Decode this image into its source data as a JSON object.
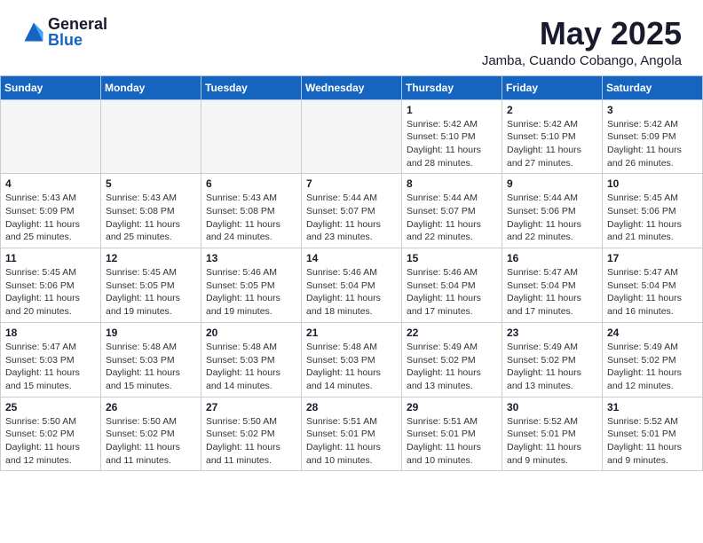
{
  "logo": {
    "general": "General",
    "blue": "Blue"
  },
  "title": {
    "month": "May 2025",
    "location": "Jamba, Cuando Cobango, Angola"
  },
  "weekdays": [
    "Sunday",
    "Monday",
    "Tuesday",
    "Wednesday",
    "Thursday",
    "Friday",
    "Saturday"
  ],
  "weeks": [
    [
      {
        "day": "",
        "detail": ""
      },
      {
        "day": "",
        "detail": ""
      },
      {
        "day": "",
        "detail": ""
      },
      {
        "day": "",
        "detail": ""
      },
      {
        "day": "1",
        "detail": "Sunrise: 5:42 AM\nSunset: 5:10 PM\nDaylight: 11 hours and 28 minutes."
      },
      {
        "day": "2",
        "detail": "Sunrise: 5:42 AM\nSunset: 5:10 PM\nDaylight: 11 hours and 27 minutes."
      },
      {
        "day": "3",
        "detail": "Sunrise: 5:42 AM\nSunset: 5:09 PM\nDaylight: 11 hours and 26 minutes."
      }
    ],
    [
      {
        "day": "4",
        "detail": "Sunrise: 5:43 AM\nSunset: 5:09 PM\nDaylight: 11 hours and 25 minutes."
      },
      {
        "day": "5",
        "detail": "Sunrise: 5:43 AM\nSunset: 5:08 PM\nDaylight: 11 hours and 25 minutes."
      },
      {
        "day": "6",
        "detail": "Sunrise: 5:43 AM\nSunset: 5:08 PM\nDaylight: 11 hours and 24 minutes."
      },
      {
        "day": "7",
        "detail": "Sunrise: 5:44 AM\nSunset: 5:07 PM\nDaylight: 11 hours and 23 minutes."
      },
      {
        "day": "8",
        "detail": "Sunrise: 5:44 AM\nSunset: 5:07 PM\nDaylight: 11 hours and 22 minutes."
      },
      {
        "day": "9",
        "detail": "Sunrise: 5:44 AM\nSunset: 5:06 PM\nDaylight: 11 hours and 22 minutes."
      },
      {
        "day": "10",
        "detail": "Sunrise: 5:45 AM\nSunset: 5:06 PM\nDaylight: 11 hours and 21 minutes."
      }
    ],
    [
      {
        "day": "11",
        "detail": "Sunrise: 5:45 AM\nSunset: 5:06 PM\nDaylight: 11 hours and 20 minutes."
      },
      {
        "day": "12",
        "detail": "Sunrise: 5:45 AM\nSunset: 5:05 PM\nDaylight: 11 hours and 19 minutes."
      },
      {
        "day": "13",
        "detail": "Sunrise: 5:46 AM\nSunset: 5:05 PM\nDaylight: 11 hours and 19 minutes."
      },
      {
        "day": "14",
        "detail": "Sunrise: 5:46 AM\nSunset: 5:04 PM\nDaylight: 11 hours and 18 minutes."
      },
      {
        "day": "15",
        "detail": "Sunrise: 5:46 AM\nSunset: 5:04 PM\nDaylight: 11 hours and 17 minutes."
      },
      {
        "day": "16",
        "detail": "Sunrise: 5:47 AM\nSunset: 5:04 PM\nDaylight: 11 hours and 17 minutes."
      },
      {
        "day": "17",
        "detail": "Sunrise: 5:47 AM\nSunset: 5:04 PM\nDaylight: 11 hours and 16 minutes."
      }
    ],
    [
      {
        "day": "18",
        "detail": "Sunrise: 5:47 AM\nSunset: 5:03 PM\nDaylight: 11 hours and 15 minutes."
      },
      {
        "day": "19",
        "detail": "Sunrise: 5:48 AM\nSunset: 5:03 PM\nDaylight: 11 hours and 15 minutes."
      },
      {
        "day": "20",
        "detail": "Sunrise: 5:48 AM\nSunset: 5:03 PM\nDaylight: 11 hours and 14 minutes."
      },
      {
        "day": "21",
        "detail": "Sunrise: 5:48 AM\nSunset: 5:03 PM\nDaylight: 11 hours and 14 minutes."
      },
      {
        "day": "22",
        "detail": "Sunrise: 5:49 AM\nSunset: 5:02 PM\nDaylight: 11 hours and 13 minutes."
      },
      {
        "day": "23",
        "detail": "Sunrise: 5:49 AM\nSunset: 5:02 PM\nDaylight: 11 hours and 13 minutes."
      },
      {
        "day": "24",
        "detail": "Sunrise: 5:49 AM\nSunset: 5:02 PM\nDaylight: 11 hours and 12 minutes."
      }
    ],
    [
      {
        "day": "25",
        "detail": "Sunrise: 5:50 AM\nSunset: 5:02 PM\nDaylight: 11 hours and 12 minutes."
      },
      {
        "day": "26",
        "detail": "Sunrise: 5:50 AM\nSunset: 5:02 PM\nDaylight: 11 hours and 11 minutes."
      },
      {
        "day": "27",
        "detail": "Sunrise: 5:50 AM\nSunset: 5:02 PM\nDaylight: 11 hours and 11 minutes."
      },
      {
        "day": "28",
        "detail": "Sunrise: 5:51 AM\nSunset: 5:01 PM\nDaylight: 11 hours and 10 minutes."
      },
      {
        "day": "29",
        "detail": "Sunrise: 5:51 AM\nSunset: 5:01 PM\nDaylight: 11 hours and 10 minutes."
      },
      {
        "day": "30",
        "detail": "Sunrise: 5:52 AM\nSunset: 5:01 PM\nDaylight: 11 hours and 9 minutes."
      },
      {
        "day": "31",
        "detail": "Sunrise: 5:52 AM\nSunset: 5:01 PM\nDaylight: 11 hours and 9 minutes."
      }
    ]
  ]
}
